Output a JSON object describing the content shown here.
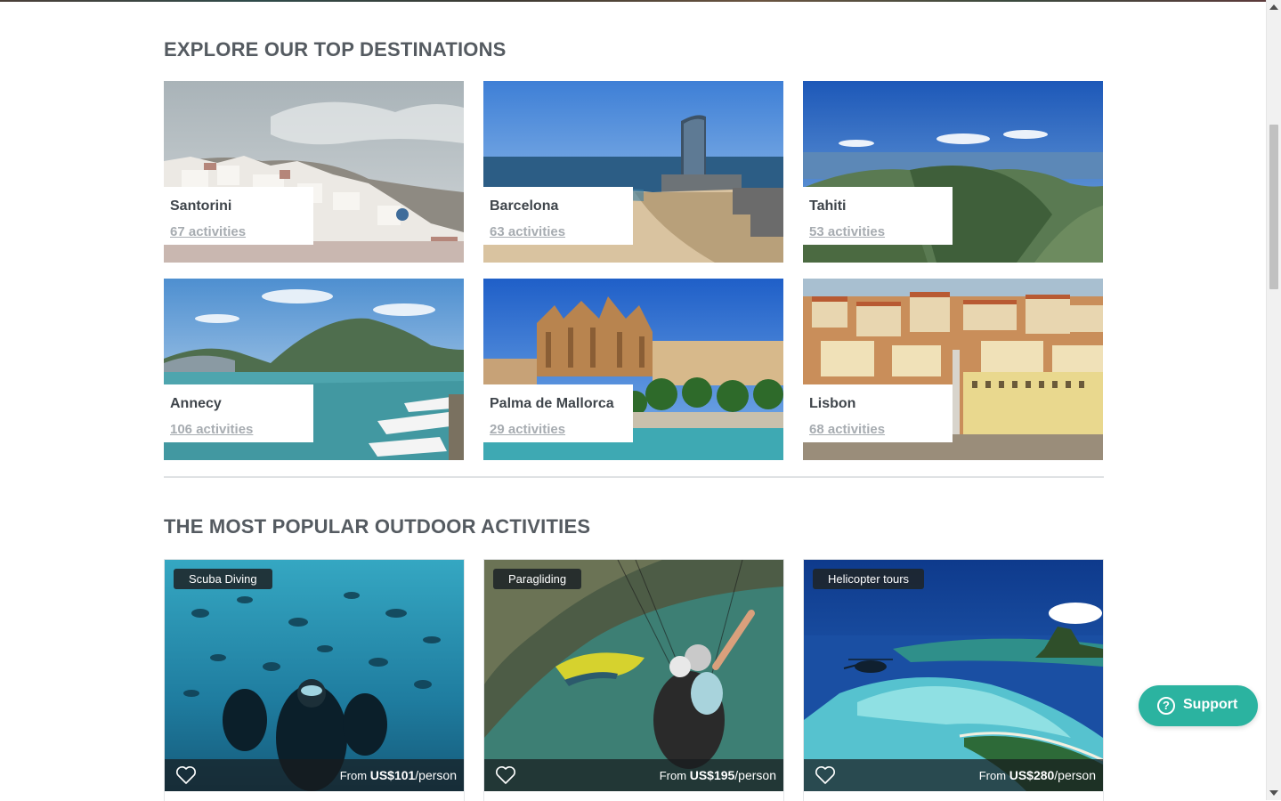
{
  "destinations_section": {
    "title": "EXPLORE OUR TOP DESTINATIONS",
    "cards": [
      {
        "name": "Santorini",
        "activities": "67 activities"
      },
      {
        "name": "Barcelona",
        "activities": "63 activities"
      },
      {
        "name": "Tahiti",
        "activities": "53 activities"
      },
      {
        "name": "Annecy",
        "activities": "106 activities"
      },
      {
        "name": "Palma de Mallorca",
        "activities": "29 activities"
      },
      {
        "name": "Lisbon",
        "activities": "68 activities"
      }
    ]
  },
  "activities_section": {
    "title": "THE MOST POPULAR OUTDOOR ACTIVITIES",
    "cards": [
      {
        "tag": "Scuba Diving",
        "from": "From",
        "price": "US$101",
        "unit": "/person"
      },
      {
        "tag": "Paragliding",
        "from": "From",
        "price": "US$195",
        "unit": "/person"
      },
      {
        "tag": "Helicopter tours",
        "from": "From",
        "price": "US$280",
        "unit": "/person"
      }
    ]
  },
  "support": {
    "label": "Support",
    "icon": "question-circle-icon",
    "color": "#2bb3a0"
  }
}
